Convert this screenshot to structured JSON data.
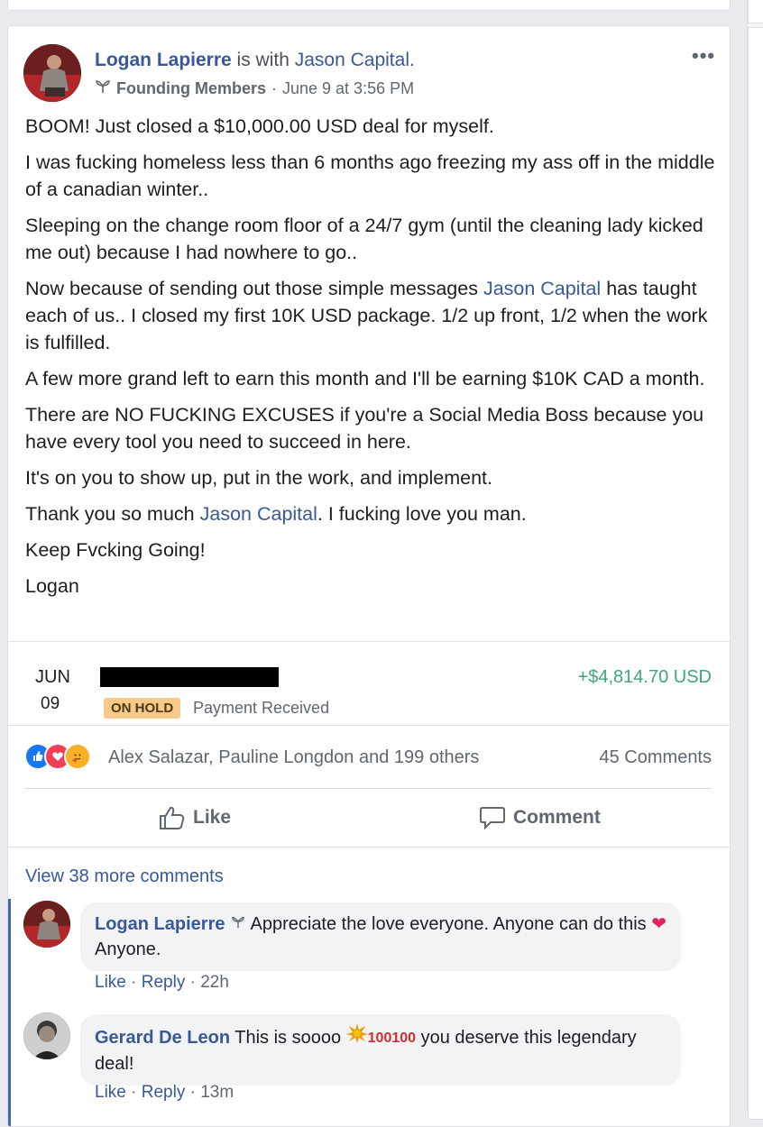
{
  "post": {
    "author": "Logan Lapierre",
    "with_text": "is with",
    "tagged": "Jason Capital.",
    "group": "Founding Members",
    "time": "June 9 at 3:56 PM",
    "more": "•••",
    "body": {
      "p1": "BOOM! Just closed a $10,000.00 USD deal for myself.",
      "p2": "I was fucking homeless less than 6 months ago freezing my ass off in the middle of a canadian winter..",
      "p3": "Sleeping on the change room floor of a 24/7 gym (until the cleaning lady kicked me out) because I had nowhere to go..",
      "p4_a": "Now because of sending out those simple messages ",
      "p4_link": "Jason Capital",
      "p4_b": " has taught each of us.. I closed my first 10K USD package. 1/2 up front, 1/2 when the work is fulfilled.",
      "p5": "A few more grand left to earn this month and I'll be earning $10K CAD a month.",
      "p6": "There are NO FUCKING EXCUSES if you're a Social Media Boss because you have every tool you need to succeed in here.",
      "p7": "It's on you to show up, put in the work, and implement.",
      "p8_a": "Thank you so much ",
      "p8_link": "Jason Capital",
      "p8_b": ". I fucking love you man.",
      "p9": "Keep Fvcking Going!",
      "p10": "Logan"
    }
  },
  "payment": {
    "month": "JUN",
    "day": "09",
    "amount": "+$4,814.70 USD",
    "status": "ON HOLD",
    "status_text": "Payment Received"
  },
  "reactions": {
    "names": "Alex Salazar, Pauline Longdon and 199 others",
    "comments": "45 Comments"
  },
  "actions": {
    "like": "Like",
    "comment": "Comment"
  },
  "comments": {
    "view_more": "View 38 more comments",
    "items": [
      {
        "name": "Logan Lapierre",
        "text_a": "Appreciate the love everyone. Anyone can do this ",
        "text_b": " Anyone.",
        "like": "Like",
        "reply": "Reply",
        "time": "22h"
      },
      {
        "name": "Gerard De Leon",
        "text_a": "This is soooo ",
        "emoji_100": "100",
        "text_b": " you deserve this legendary deal!",
        "like": "Like",
        "reply": "Reply",
        "time": "13m"
      }
    ]
  },
  "colors": {
    "link": "#385898",
    "amount": "#42a47a",
    "badge": "#f7c98b"
  }
}
